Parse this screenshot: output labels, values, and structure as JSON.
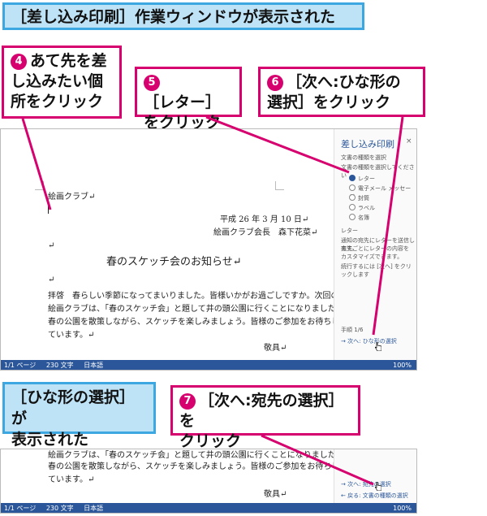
{
  "labels": {
    "top": "［差し込み印刷］作業ウィンドウが表示された",
    "bottom_line1": "［ひな形の選択］が",
    "bottom_line2": "表示された"
  },
  "callouts": {
    "c4": {
      "num": "4",
      "line1": "あて先を差",
      "line2": "し込みたい個",
      "line3": "所をクリック"
    },
    "c5": {
      "num": "5",
      "line1": "［レター］",
      "line2": "をクリック"
    },
    "c6": {
      "num": "6",
      "line1": "［次へ:ひな形の",
      "line2": "選択］をクリック"
    },
    "c7": {
      "num": "7",
      "line1": "［次へ:宛先の選択］を",
      "line2": "クリック"
    }
  },
  "document": {
    "sender": "絵画クラブ↵",
    "date": "平成 26 年 3 月 10 日↵",
    "from": "絵画クラブ会長　森下花菜↵",
    "title": "春のスケッチ会のお知らせ↵",
    "body1": "拝啓　春らしい季節になってまいりました。皆様いかがお過ごしですか。次回の",
    "body2": "絵画クラブは、「春のスケッチ会」と題して井の頭公園に行くことになりました。",
    "body3": "春の公園を散策しながら、スケッチを楽しみましょう。皆様のご参加をお待ちし",
    "body4": "ています。↵",
    "closing": "敬具↵",
    "mark": "↵"
  },
  "pane": {
    "title": "差し込み印刷",
    "section1": "文書の種類を選択",
    "instruction": "文書の種類を選択してください",
    "options": [
      "レター",
      "電子メール メッセージ",
      "封筒",
      "ラベル",
      "名簿"
    ],
    "section2": "レター",
    "desc1": "通知の宛先にレターを送信します。",
    "desc2": "宛先ごとにレターの内容を",
    "desc3": "カスタマイズできます。",
    "desc4": "続行するには [次へ] をクリックします",
    "step": "手順 1/6",
    "next_link": "次へ: ひな形の選択",
    "next_link2": "次へ: 宛先の選択",
    "back_link": "戻る: 文書の種類の選択",
    "close": "×",
    "arrow": "→"
  },
  "status": {
    "page": "1/1 ページ",
    "words": "230 文字",
    "lang": "日本語",
    "zoom": "100%"
  },
  "colors": {
    "accent_red": "#d6006f",
    "label_blue": "#3ca7e0",
    "word_blue": "#2b579a"
  }
}
